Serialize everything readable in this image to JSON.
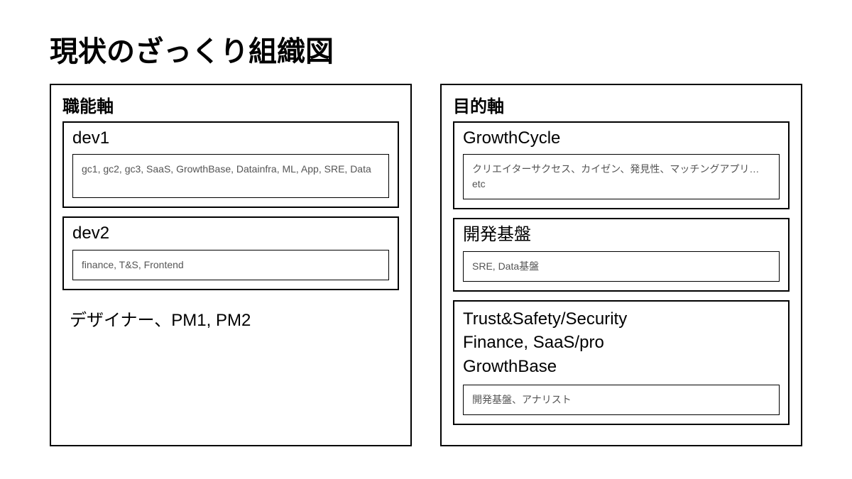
{
  "title": "現状のざっくり組織図",
  "left": {
    "axis_title": "職能軸",
    "dev1": {
      "title": "dev1",
      "items": "gc1, gc2, gc3, SaaS, GrowthBase, Datainfra, ML, App, SRE, Data"
    },
    "dev2": {
      "title": "dev2",
      "items": "finance, T&S, Frontend"
    },
    "others": "デザイナー、PM1, PM2"
  },
  "right": {
    "axis_title": "目的軸",
    "growth_cycle": {
      "title": "GrowthCycle",
      "items": "クリエイターサクセス、カイゼン、発見性、マッチングアプリ…etc"
    },
    "dev_base": {
      "title": "開発基盤",
      "items": "SRE, Data基盤"
    },
    "multi": {
      "title": "Trust&Safety/Security\nFinance, SaaS/pro\nGrowthBase",
      "items": "開発基盤、アナリスト"
    }
  }
}
